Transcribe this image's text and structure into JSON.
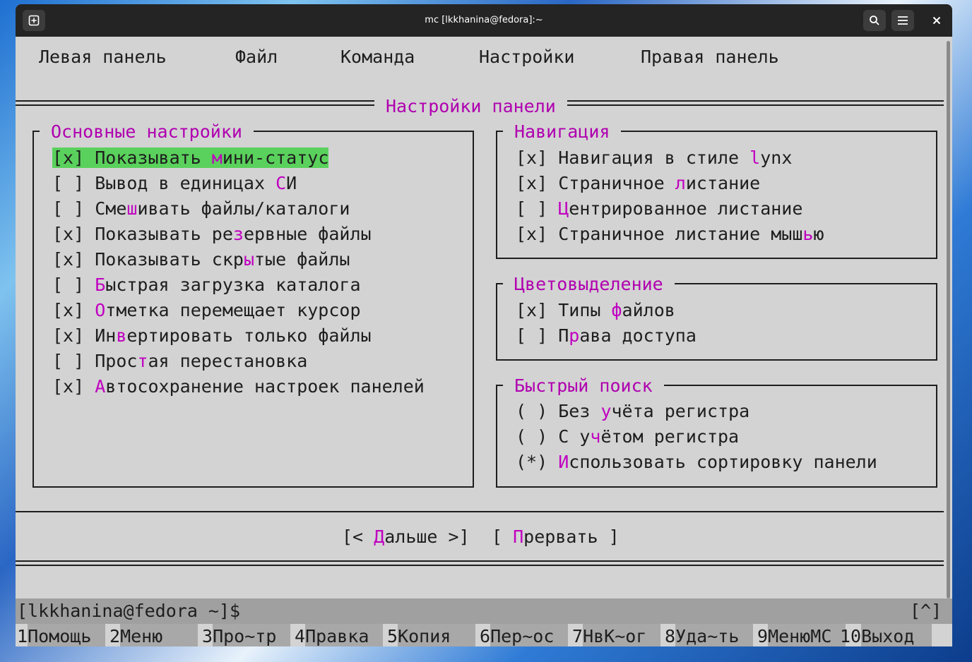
{
  "window": {
    "title": "mc [lkkhanina@fedora]:~"
  },
  "titlebar_icons": {
    "new_tab": "new-tab-icon",
    "search": "search-icon",
    "menu": "hamburger-menu-icon",
    "close": "close-icon"
  },
  "menubar": [
    "Левая панель",
    "Файл",
    "Команда",
    "Настройки",
    "Правая панель"
  ],
  "dialog": {
    "title": "Настройки панели",
    "main_settings": {
      "title": "Основные настройки",
      "items": [
        {
          "mark": "[x]",
          "pre": "Показывать ",
          "hot": "м",
          "post": "ини-статус"
        },
        {
          "mark": "[ ]",
          "pre": "Вывод в единицах ",
          "hot": "С",
          "post": "И"
        },
        {
          "mark": "[ ]",
          "pre": "Сме",
          "hot": "ш",
          "post": "ивать файлы/каталоги"
        },
        {
          "mark": "[x]",
          "pre": "Показывать ре",
          "hot": "з",
          "post": "ервные файлы"
        },
        {
          "mark": "[x]",
          "pre": "Показывать скр",
          "hot": "ы",
          "post": "тые файлы"
        },
        {
          "mark": "[ ]",
          "pre": "",
          "hot": "Б",
          "post": "ыстрая загрузка каталога"
        },
        {
          "mark": "[x]",
          "pre": "",
          "hot": "О",
          "post": "тметка перемещает курсор"
        },
        {
          "mark": "[x]",
          "pre": "Ин",
          "hot": "в",
          "post": "ертировать только файлы"
        },
        {
          "mark": "[ ]",
          "pre": "Прос",
          "hot": "т",
          "post": "ая перестановка"
        },
        {
          "mark": "[x]",
          "pre": "",
          "hot": "А",
          "post": "втосохранение настроек панелей"
        }
      ]
    },
    "navigation": {
      "title": "Навигация",
      "items": [
        {
          "mark": "[x]",
          "pre": "Навигация в стиле ",
          "hot": "l",
          "post": "ynx"
        },
        {
          "mark": "[x]",
          "pre": "Страничное ",
          "hot": "л",
          "post": "истание"
        },
        {
          "mark": "[ ]",
          "pre": "",
          "hot": "Ц",
          "post": "ентрированное листание"
        },
        {
          "mark": "[x]",
          "pre": "Страничное листание мыш",
          "hot": "ь",
          "post": "ю"
        }
      ]
    },
    "highlighting": {
      "title": "Цветовыделение",
      "items": [
        {
          "mark": "[x]",
          "pre": "Типы ",
          "hot": "ф",
          "post": "айлов"
        },
        {
          "mark": "[ ]",
          "pre": "П",
          "hot": "р",
          "post": "ава доступа"
        }
      ]
    },
    "quick_search": {
      "title": "Быстрый поиск",
      "items": [
        {
          "mark": "( )",
          "pre": "Без ",
          "hot": "у",
          "post": "чёта регистра"
        },
        {
          "mark": "( )",
          "pre": "С у",
          "hot": "ч",
          "post": "ётом регистра"
        },
        {
          "mark": "(*)",
          "pre": "",
          "hot": "И",
          "post": "спользовать сортировку панели"
        }
      ]
    },
    "buttons": {
      "next": {
        "open": "[< ",
        "hot": "Д",
        "rest": "альше >]"
      },
      "abort": {
        "open": "[ ",
        "hot": "П",
        "rest": "рервать ]"
      }
    }
  },
  "prompt": "[lkkhanina@fedora ~]$",
  "prompt_right": "[^]",
  "fkeys": [
    {
      "num": "1",
      "label": "Помощь"
    },
    {
      "num": "2",
      "label": "Меню"
    },
    {
      "num": "3",
      "label": "Про~тр"
    },
    {
      "num": "4",
      "label": "Правка"
    },
    {
      "num": "5",
      "label": "Копия"
    },
    {
      "num": "6",
      "label": "Пер~ос"
    },
    {
      "num": "7",
      "label": "НвК~ог"
    },
    {
      "num": "8",
      "label": "Уда~ть"
    },
    {
      "num": "9",
      "label": "МенюМС"
    },
    {
      "num": "10",
      "label": "Выход"
    }
  ],
  "colors": {
    "hotkey": "#b000b0",
    "selected": "#5ad15c",
    "term_bg": "#d3d3d3",
    "titlebar": "#242424"
  }
}
